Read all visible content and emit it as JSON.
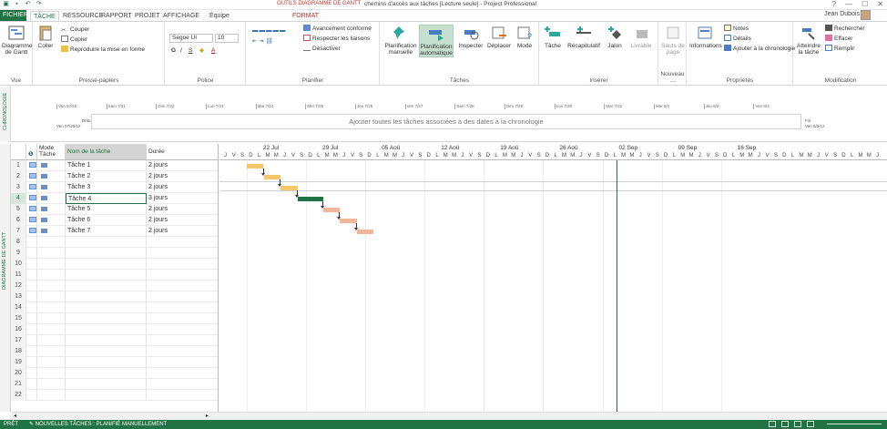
{
  "window": {
    "context_tab_group": "OUTILS DIAGRAMME DE GANTT",
    "document_title": "chemins d'accès aux tâches [Lecture seule] - Project Professional",
    "controls": [
      "?",
      "—",
      "☐",
      "✕"
    ]
  },
  "tabs": [
    {
      "label": "FICHIER"
    },
    {
      "label": "TÂCHE"
    },
    {
      "label": "RESSOURCE"
    },
    {
      "label": "RAPPORT"
    },
    {
      "label": "PROJET"
    },
    {
      "label": "AFFICHAGE"
    },
    {
      "label": "Équipe"
    },
    {
      "label": "FORMAT"
    }
  ],
  "user": "Jean Dubois",
  "ribbon": {
    "vue": {
      "label": "Vue",
      "gantt": "Diagramme de Gantt"
    },
    "presse_papiers": {
      "label": "Presse-papiers",
      "coller": "Coller",
      "couper": "Couper",
      "copier": "Copier",
      "reproduire": "Reproduire la mise en forme"
    },
    "police": {
      "label": "Police",
      "font": "Segoe UI",
      "size": "10",
      "bold": "G",
      "italic": "I",
      "underline": "S"
    },
    "planifier": {
      "label": "Planifier",
      "avancement": "Avancement conforme",
      "respecter": "Respecter les liaisons",
      "desactiver": "Désactiver"
    },
    "taches": {
      "label": "Tâches",
      "manuelle": "Planification manuelle",
      "automatique": "Planification automatique",
      "inspecter": "Inspecter",
      "deplacer": "Déplacer",
      "mode": "Mode"
    },
    "inserer": {
      "label": "Insérer",
      "tache": "Tâche",
      "recap": "Récapitulatif",
      "jalon": "Jalon",
      "livrable": "Livrable"
    },
    "nouveau": {
      "label": "Nouveau ...",
      "sauts": "Sauts de page"
    },
    "proprietes": {
      "label": "Propriétés",
      "informations": "Informations",
      "notes": "Notes",
      "details": "Détails",
      "ajouter": "Ajouter à la chronologie"
    },
    "modification": {
      "label": "Modification",
      "atteindre": "Atteindre la tâche",
      "rechercher": "Rechercher",
      "effacer": "Effacer",
      "remplir": "Remplir"
    }
  },
  "timeline": {
    "side_label": "CHRONOLOGIE",
    "start_label": "Début",
    "start_date": "Ven 07/20/12",
    "end_label": "Fin",
    "end_date": "Ven 8/3/12",
    "placeholder": "Ajouter toutes les tâches associées à des dates à la chronologie",
    "ticks": [
      "Ven 07/20",
      "Sam 7/21",
      "Dim 7/22",
      "Lun 7/23",
      "Mar 7/24",
      "Mer 7/25",
      "Jeu 7/26",
      "Ven 7/27",
      "Sam 7/28",
      "Dim 7/29",
      "Lun 7/30",
      "Mar 7/31",
      "Mer 8/1",
      "Jeu 8/2",
      "Ven 8/3"
    ]
  },
  "grid": {
    "side_label": "DIAGRAMME DE GANTT",
    "headers": {
      "mode": "Mode Tâche",
      "name": "Nom de la tâche",
      "duration": "Durée"
    },
    "rows": [
      {
        "id": "1",
        "name": "Tâche 1",
        "duration": "2 jours"
      },
      {
        "id": "2",
        "name": "Tâche 2",
        "duration": "2 jours"
      },
      {
        "id": "3",
        "name": "Tâche 3",
        "duration": "2 jours"
      },
      {
        "id": "4",
        "name": "Tâche 4",
        "duration": "3 jours"
      },
      {
        "id": "5",
        "name": "Tâche 5",
        "duration": "2 jours"
      },
      {
        "id": "6",
        "name": "Tâche 6",
        "duration": "2 jours"
      },
      {
        "id": "7",
        "name": "Tâche 7",
        "duration": "2 jours"
      }
    ],
    "empty_row_nums": [
      "8",
      "9",
      "10",
      "11",
      "12",
      "13",
      "14",
      "15",
      "16",
      "17",
      "18",
      "19",
      "20",
      "21",
      "22"
    ]
  },
  "chart": {
    "weeks": [
      "22 Jul",
      "29 Jul",
      "05 Aoû",
      "12 Aoû",
      "19 Aoû",
      "26 Aoû",
      "02 Sep",
      "09 Sep",
      "16 Sep"
    ],
    "first_day": "J",
    "day_letters": [
      "V",
      "S",
      "D",
      "L",
      "M",
      "M",
      "J"
    ],
    "colors": {
      "task": "#f5c66a",
      "critical": "#f2b59a",
      "selected": "#217346"
    },
    "bars": [
      {
        "row": 0,
        "start": 3,
        "len": 2,
        "kind": "task"
      },
      {
        "row": 1,
        "start": 5,
        "len": 2,
        "kind": "task"
      },
      {
        "row": 2,
        "start": 7,
        "len": 2,
        "kind": "task"
      },
      {
        "row": 3,
        "start": 9,
        "len": 3,
        "kind": "selected"
      },
      {
        "row": 4,
        "start": 12,
        "len": 2,
        "kind": "critical"
      },
      {
        "row": 5,
        "start": 14,
        "len": 2,
        "kind": "critical"
      },
      {
        "row": 6,
        "start": 16,
        "len": 2,
        "kind": "critical"
      }
    ]
  },
  "status": {
    "ready": "PRÊT",
    "new_tasks": "NOUVELLES TÂCHES : PLANIFIÉ MANUELLEMENT"
  }
}
